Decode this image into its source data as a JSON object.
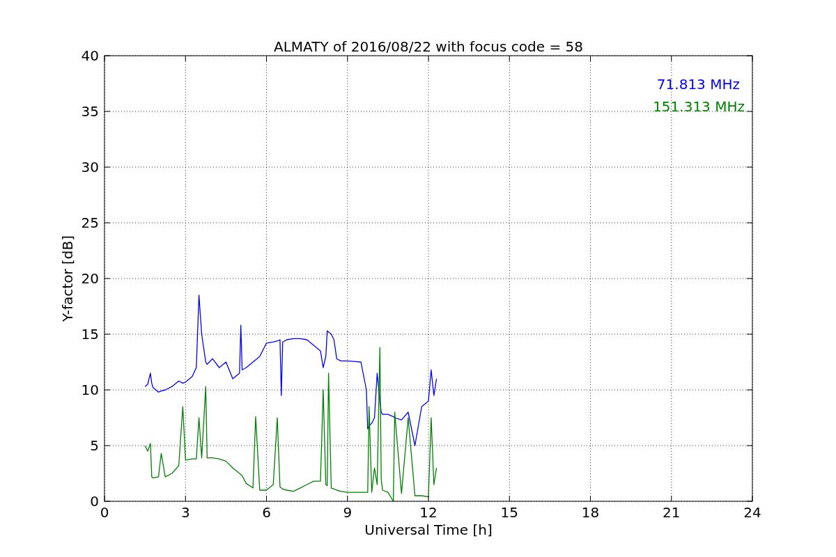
{
  "figure": {
    "chart_data": {
      "type": "line",
      "title": "ALMATY of 2016/08/22 with focus code = 58",
      "xlabel": "Universal Time [h]",
      "ylabel": "Y-factor [dB]",
      "x": [
        1.5,
        1.6,
        1.7,
        1.75,
        1.8,
        2.0,
        2.1,
        2.25,
        2.5,
        2.75,
        2.9,
        3.0,
        3.25,
        3.4,
        3.5,
        3.6,
        3.75,
        3.8,
        4.0,
        4.25,
        4.5,
        4.75,
        5.0,
        5.05,
        5.1,
        5.25,
        5.5,
        5.6,
        5.75,
        6.0,
        6.25,
        6.4,
        6.5,
        6.55,
        6.6,
        6.75,
        7.0,
        7.25,
        7.5,
        7.75,
        8.0,
        8.1,
        8.2,
        8.25,
        8.3,
        8.4,
        8.5,
        8.6,
        8.75,
        9.0,
        9.5,
        9.7,
        9.75,
        9.8,
        9.9,
        10.0,
        10.1,
        10.2,
        10.25,
        10.3,
        10.5,
        10.7,
        10.75,
        11.0,
        11.25,
        11.5,
        11.75,
        12.0,
        12.1,
        12.2,
        12.3
      ],
      "series": [
        {
          "name": "71.813 MHz",
          "color": "#0000ff",
          "values": [
            10.3,
            10.5,
            11.5,
            10.6,
            10.2,
            9.8,
            9.9,
            10.0,
            10.3,
            10.8,
            10.6,
            10.7,
            11.2,
            12,
            18.5,
            15,
            12.5,
            12.3,
            12.8,
            12.0,
            12.5,
            11.0,
            11.5,
            15.8,
            11.8,
            12.0,
            12.5,
            12.7,
            13.0,
            14.2,
            14.3,
            14.4,
            14.5,
            9.5,
            14.3,
            14.5,
            14.6,
            14.6,
            14.5,
            14.0,
            13.5,
            12.0,
            13.0,
            15.3,
            15.2,
            15.0,
            14.5,
            12.8,
            12.6,
            12.6,
            12.5,
            10,
            6.5,
            6.8,
            7.0,
            7.5,
            11.5,
            9.0,
            8.0,
            7.8,
            7.8,
            7.6,
            7.5,
            7.3,
            8.0,
            5.0,
            8.5,
            9.0,
            11.8,
            9.5,
            11.0
          ]
        },
        {
          "name": "151.313 MHz",
          "color": "#008000",
          "values": [
            5.0,
            4.5,
            5.2,
            2.2,
            2.1,
            2.2,
            4.3,
            2.2,
            2.5,
            3.2,
            8.5,
            3.7,
            3.8,
            3.8,
            7.5,
            3.9,
            10.3,
            3.9,
            3.9,
            3.8,
            3.6,
            3.0,
            2.5,
            2.4,
            2.3,
            1.6,
            1.2,
            7.6,
            1.0,
            1.0,
            1.5,
            7.5,
            1.3,
            1.2,
            1.1,
            1.0,
            0.9,
            1.2,
            1.5,
            1.8,
            1.8,
            10.0,
            1.5,
            1.4,
            11.5,
            1.2,
            1.1,
            1.0,
            0.9,
            0.8,
            0.8,
            0.8,
            0.8,
            8.5,
            0.8,
            3.0,
            1.5,
            13.8,
            2.0,
            1.0,
            0.8,
            0.0,
            8.0,
            0.7,
            7.5,
            0.5,
            0.5,
            0.4,
            7.5,
            1.5,
            3.0
          ]
        }
      ],
      "grid": true,
      "xlim": [
        0,
        24
      ],
      "ylim": [
        0,
        40
      ],
      "xticks": [
        0,
        3,
        6,
        9,
        12,
        15,
        18,
        21,
        24
      ],
      "yticks": [
        0,
        5,
        10,
        15,
        20,
        25,
        30,
        35,
        40
      ]
    }
  }
}
